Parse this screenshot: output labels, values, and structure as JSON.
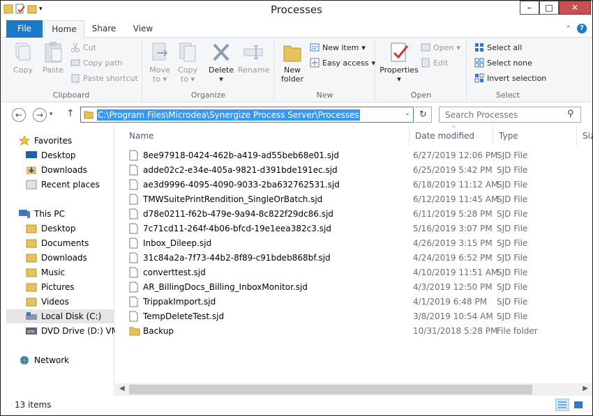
{
  "window": {
    "title": "Processes",
    "minimize_glyph": "–",
    "maximize_glyph": "□",
    "close_glyph": "✕"
  },
  "ribbon_tabs": [
    {
      "label": "File"
    },
    {
      "label": "Home"
    },
    {
      "label": "Share"
    },
    {
      "label": "View"
    }
  ],
  "ribbon": {
    "clipboard": {
      "label": "Clipboard",
      "copy": "Copy",
      "paste": "Paste",
      "cut": "Cut",
      "copy_path": "Copy path",
      "paste_shortcut": "Paste shortcut"
    },
    "organize": {
      "label": "Organize",
      "move_to": "Move",
      "move_to_2": "to",
      "copy_to": "Copy",
      "copy_to_2": "to",
      "delete": "Delete",
      "rename": "Rename"
    },
    "new": {
      "label": "New",
      "new_folder": "New",
      "new_folder_2": "folder",
      "new_item": "New item",
      "easy_access": "Easy access"
    },
    "open": {
      "label": "Open",
      "properties": "Properties",
      "open": "Open",
      "edit": "Edit"
    },
    "select": {
      "label": "Select",
      "select_all": "Select all",
      "select_none": "Select none",
      "invert_selection": "Invert selection"
    }
  },
  "address": {
    "path": "C:\\Program Files\\Microdea\\Synergize Process Server\\Processes",
    "search_placeholder": "Search Processes"
  },
  "nav": {
    "favorites": "Favorites",
    "favorites_items": [
      "Desktop",
      "Downloads",
      "Recent places"
    ],
    "this_pc": "This PC",
    "this_pc_items": [
      "Desktop",
      "Documents",
      "Downloads",
      "Music",
      "Pictures",
      "Videos",
      "Local Disk (C:)",
      "DVD Drive (D:) VMw"
    ],
    "network": "Network"
  },
  "columns": {
    "name": "Name",
    "date_modified": "Date modified",
    "type": "Type",
    "size": "Siz"
  },
  "files": [
    {
      "name": "8ee97918-0424-462b-a419-ad55beb68e01.sjd",
      "date": "6/27/2019 12:06 PM",
      "type": "SJD File",
      "kind": "file"
    },
    {
      "name": "adde02c2-e34e-405a-9821-d391bde191ec.sjd",
      "date": "6/25/2019 5:42 PM",
      "type": "SJD File",
      "kind": "file"
    },
    {
      "name": "ae3d9996-4095-4090-9033-2ba632762531.sjd",
      "date": "6/18/2019 11:12 AM",
      "type": "SJD File",
      "kind": "file"
    },
    {
      "name": "TMWSuitePrintRendition_SingleOrBatch.sjd",
      "date": "6/12/2019 11:45 AM",
      "type": "SJD File",
      "kind": "file"
    },
    {
      "name": "d78e0211-f62b-479e-9a94-8c822f29dc86.sjd",
      "date": "6/11/2019 5:28 PM",
      "type": "SJD File",
      "kind": "file"
    },
    {
      "name": "7c71cd11-264f-4b06-bfcd-19e1eea382c3.sjd",
      "date": "5/16/2019 3:07 PM",
      "type": "SJD File",
      "kind": "file"
    },
    {
      "name": "Inbox_Dileep.sjd",
      "date": "4/26/2019 3:15 PM",
      "type": "SJD File",
      "kind": "file"
    },
    {
      "name": "31c84a2a-7f73-44b2-8f89-c91bdeb868bf.sjd",
      "date": "4/24/2019 6:52 PM",
      "type": "SJD File",
      "kind": "file"
    },
    {
      "name": "converttest.sjd",
      "date": "4/10/2019 11:51 AM",
      "type": "SJD File",
      "kind": "file"
    },
    {
      "name": "AR_BillingDocs_Billing_InboxMonitor.sjd",
      "date": "4/3/2019 12:50 PM",
      "type": "SJD File",
      "kind": "file"
    },
    {
      "name": "TrippakImport.sjd",
      "date": "4/1/2019 6:48 PM",
      "type": "SJD File",
      "kind": "file"
    },
    {
      "name": "TempDeleteTest.sjd",
      "date": "3/8/2019 10:54 AM",
      "type": "SJD File",
      "kind": "file"
    },
    {
      "name": "Backup",
      "date": "10/31/2018 5:28 PM",
      "type": "File folder",
      "kind": "folder"
    }
  ],
  "status": {
    "item_count": "13 items"
  },
  "colors": {
    "accent": "#1979ca",
    "selection": "#3399ff",
    "folder": "#e8c35a"
  }
}
